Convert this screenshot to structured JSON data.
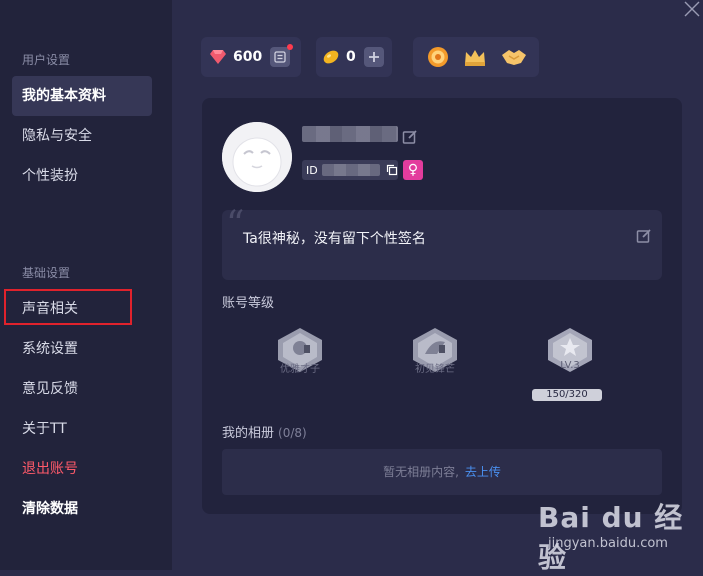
{
  "sidebar": {
    "user_settings_title": "用户设置",
    "user_items": [
      {
        "label": "我的基本资料",
        "active": true
      },
      {
        "label": "隐私与安全"
      },
      {
        "label": "个性装扮"
      }
    ],
    "basic_settings_title": "基础设置",
    "basic_items": [
      {
        "label": "声音相关",
        "highlighted": true
      },
      {
        "label": "系统设置"
      },
      {
        "label": "意见反馈"
      },
      {
        "label": "关于TT"
      },
      {
        "label": "退出账号",
        "color": "#ff5a6a"
      },
      {
        "label": "清除数据"
      }
    ]
  },
  "top_bar": {
    "diamond_count": "600",
    "bean_count": "0"
  },
  "profile": {
    "id_prefix": "ID",
    "signature": "Ta很神秘，没有留下个性签名",
    "level_section_title": "账号等级",
    "badges": [
      {
        "name": "优雅才子"
      },
      {
        "name": "初见锋芒"
      },
      {
        "name": "LV.3"
      }
    ],
    "level_progress": "150/320",
    "album_title": "我的相册",
    "album_count": "(0/8)",
    "album_empty_text": "暂无相册内容,",
    "album_upload_link": "去上传"
  },
  "watermark": {
    "logo": "Bai du 经验",
    "url": "jingyan.baidu.com"
  },
  "colors": {
    "accent_link": "#4a90f0",
    "danger": "#ff5a6a",
    "gender_female": "#e33c9d"
  }
}
